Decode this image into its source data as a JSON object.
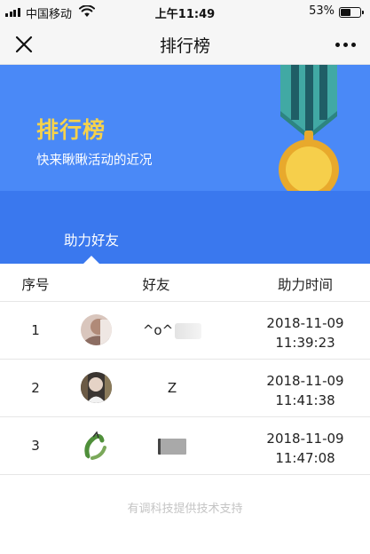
{
  "status_bar": {
    "carrier": "中国移动",
    "time": "上午11:49",
    "battery_percent": "53%",
    "battery_level": 0.53
  },
  "nav": {
    "title": "排行榜",
    "close_icon": "close-icon",
    "more_icon": "more-icon"
  },
  "banner": {
    "title": "排行榜",
    "subtitle": "快来瞅瞅活动的近况",
    "icon": "medal-icon",
    "colors": {
      "background": "#4a89f7",
      "title": "#f6d24c",
      "tab_bar": "#3a78ee"
    }
  },
  "tabs": [
    {
      "label": "助力好友",
      "active": true
    }
  ],
  "table": {
    "headers": {
      "rank": "序号",
      "friend": "好友",
      "time": "助力时间"
    },
    "rows": [
      {
        "rank": "1",
        "name": "^o^",
        "date": "2018-11-09",
        "time": "11:39:23"
      },
      {
        "rank": "2",
        "name": "Z",
        "date": "2018-11-09",
        "time": "11:41:38"
      },
      {
        "rank": "3",
        "name": "",
        "date": "2018-11-09",
        "time": "11:47:08"
      }
    ]
  },
  "footer": {
    "text": "有调科技提供技术支持"
  }
}
